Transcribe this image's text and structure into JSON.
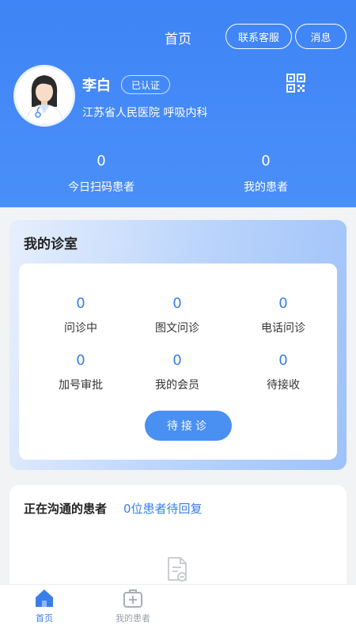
{
  "header": {
    "title": "首页",
    "service_button": "联系客服",
    "message_button": "消息"
  },
  "profile": {
    "name": "李白",
    "badge": "已认证",
    "hospital_dept": "江苏省人民医院 呼吸内科"
  },
  "stats": {
    "today_scanned": {
      "value": "0",
      "label": "今日扫码患者"
    },
    "my_patients": {
      "value": "0",
      "label": "我的患者"
    }
  },
  "clinic": {
    "title": "我的诊室",
    "items": [
      {
        "value": "0",
        "label": "问诊中"
      },
      {
        "value": "0",
        "label": "图文问诊"
      },
      {
        "value": "0",
        "label": "电话问诊"
      },
      {
        "value": "0",
        "label": "加号审批"
      },
      {
        "value": "0",
        "label": "我的会员"
      },
      {
        "value": "0",
        "label": "待接收"
      }
    ],
    "wait_button": "待接诊"
  },
  "communicating": {
    "title": "正在沟通的患者",
    "count_text": "0位患者待回复"
  },
  "tabbar": {
    "items": [
      {
        "label": "首页"
      },
      {
        "label": "我的患者"
      }
    ]
  },
  "colors": {
    "primary": "#4a8ff2",
    "header_bg": "#3f84f6",
    "accent_text": "#3a7ee8"
  }
}
